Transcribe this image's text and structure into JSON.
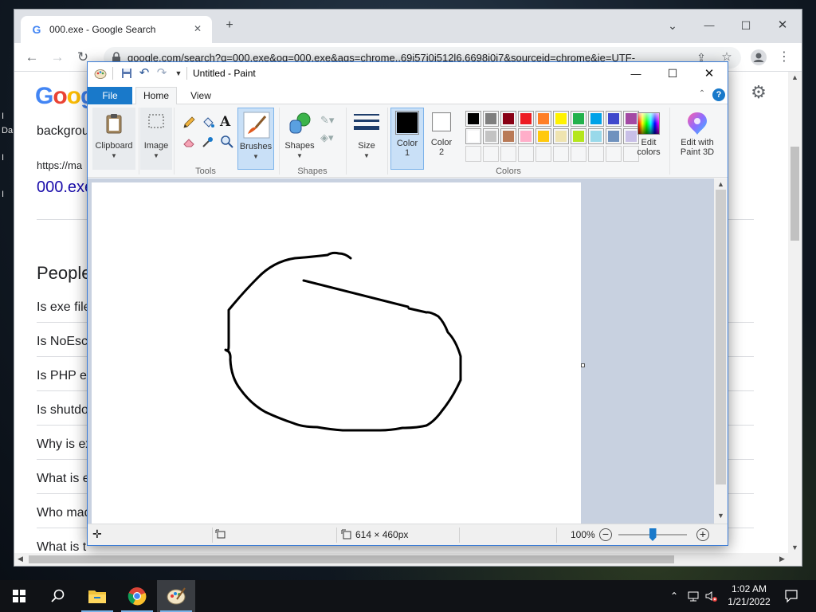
{
  "desktop": {
    "icon_labels": [
      "I",
      "Da",
      "I",
      "I"
    ]
  },
  "chrome": {
    "tab_title": "000.exe - Google Search",
    "tab_close": "✕",
    "new_tab": "+",
    "win_min": "—",
    "win_max": "☐",
    "win_close": "✕",
    "tab_search": "⌄",
    "url": "google.com/search?q=000.exe&oq=000.exe&aqs=chrome..69i57j0i512l6.6698j0j7&sourceid=chrome&ie=UTF-",
    "logo_letters": [
      "G",
      "o",
      "o",
      "g"
    ],
    "serp": {
      "snippet_text": "backgrou",
      "cite_url": "https://ma",
      "result_link": "000.exe",
      "people_heading": "People",
      "questions": [
        "Is exe file",
        "Is NoEsc",
        "Is PHP e",
        "Is shutdo",
        "Why is ex",
        "What is e",
        "Who mad",
        "What is t"
      ]
    }
  },
  "paint": {
    "title": "Untitled - Paint",
    "tabs": {
      "file": "File",
      "home": "Home",
      "view": "View"
    },
    "help": "?",
    "ribbon": {
      "clipboard": "Clipboard",
      "image": "Image",
      "tools_group": "Tools",
      "brushes": "Brushes",
      "shapes": "Shapes",
      "shapes_group": "Shapes",
      "size": "Size",
      "color1": "Color\n1",
      "color1_a": "Color",
      "color1_b": "1",
      "color2_a": "Color",
      "color2_b": "2",
      "colors_group": "Colors",
      "edit_colors_a": "Edit",
      "edit_colors_b": "colors",
      "paint3d_a": "Edit with",
      "paint3d_b": "Paint 3D",
      "text_tool": "A"
    },
    "palette_row1": [
      "#000000",
      "#7f7f7f",
      "#880015",
      "#ed1c24",
      "#ff7f27",
      "#fff200",
      "#22b14c",
      "#00a2e8",
      "#3f48cc",
      "#a349a4"
    ],
    "palette_row2": [
      "#ffffff",
      "#c3c3c3",
      "#b97a57",
      "#ffaec9",
      "#ffc90e",
      "#efe4b0",
      "#b5e61d",
      "#99d9ea",
      "#7092be",
      "#c8bfe7"
    ],
    "color1_value": "#000000",
    "color2_value": "#ffffff",
    "status": {
      "canvas_size": "614 × 460px",
      "zoom": "100%",
      "zoom_level_percent": 100
    }
  },
  "taskbar": {
    "time": "1:02 AM",
    "date": "1/21/2022"
  }
}
